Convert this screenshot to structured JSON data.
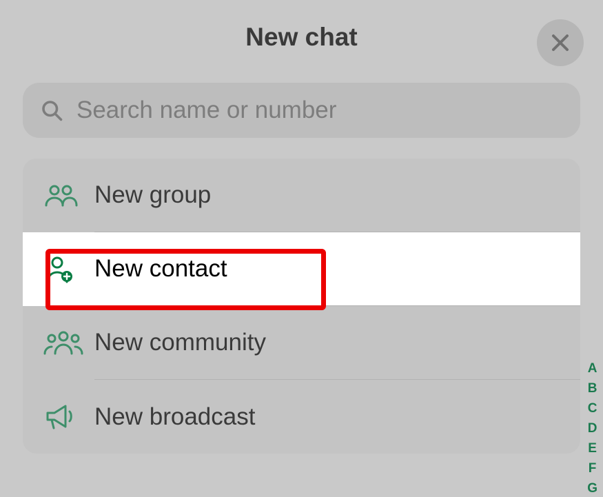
{
  "header": {
    "title": "New chat",
    "close_icon": "close-icon"
  },
  "search": {
    "placeholder": "Search name or number"
  },
  "menu": {
    "items": [
      {
        "label": "New group",
        "icon": "group-icon"
      },
      {
        "label": "New contact",
        "icon": "add-contact-icon",
        "highlighted": true
      },
      {
        "label": "New community",
        "icon": "community-icon"
      },
      {
        "label": "New broadcast",
        "icon": "megaphone-icon"
      }
    ]
  },
  "az_index": [
    "A",
    "B",
    "C",
    "D",
    "E",
    "F",
    "G"
  ],
  "colors": {
    "accent_green": "#128C4B",
    "highlight_red": "#eb0000"
  }
}
